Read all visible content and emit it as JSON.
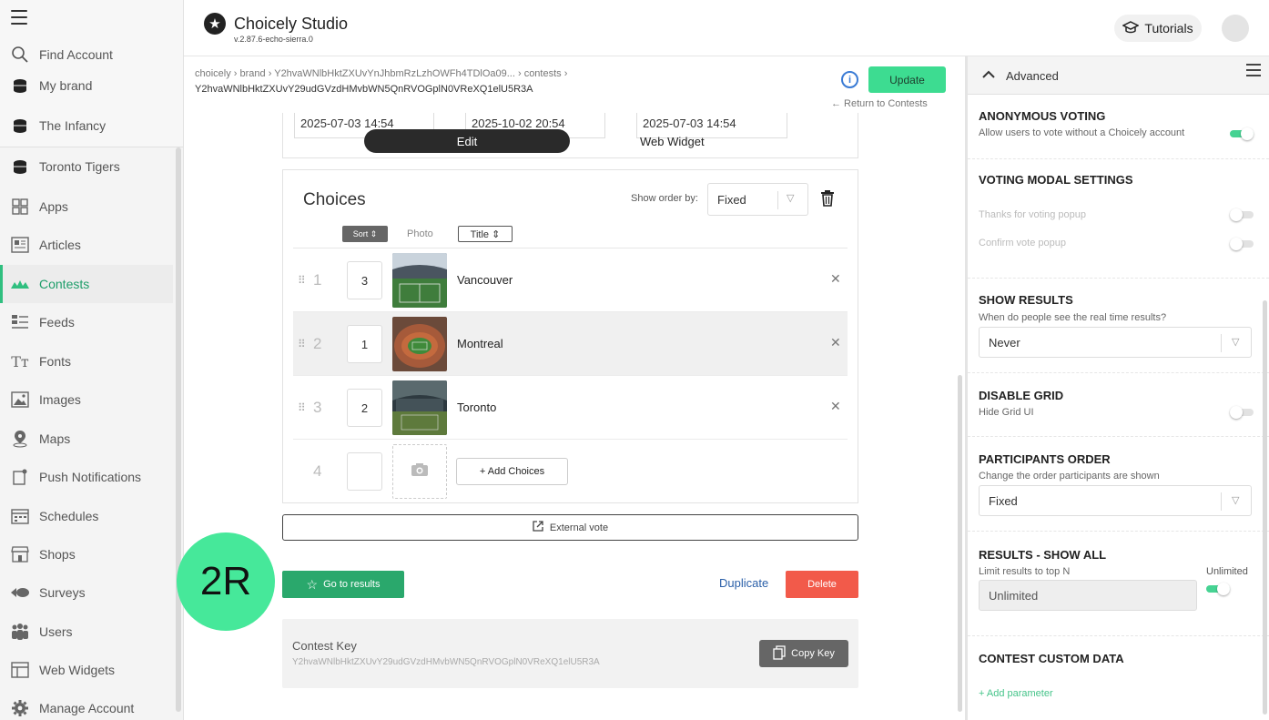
{
  "app": {
    "title": "Choicely Studio",
    "version": "v.2.87.6-echo-sierra.0",
    "tutorials_label": "Tutorials",
    "update_label": "Update",
    "return_label": "← Return to Contests"
  },
  "sidebar": {
    "items": [
      {
        "label": "Find Account",
        "icon": "search-icon"
      },
      {
        "label": "My brand",
        "icon": "brand-icon"
      },
      {
        "label": "The Infancy",
        "icon": "brand-icon"
      },
      {
        "label": "Toronto Tigers",
        "icon": "brand-icon"
      },
      {
        "label": "Apps",
        "icon": "apps-icon"
      },
      {
        "label": "Articles",
        "icon": "articles-icon"
      },
      {
        "label": "Contests",
        "icon": "contests-icon"
      },
      {
        "label": "Feeds",
        "icon": "feeds-icon"
      },
      {
        "label": "Fonts",
        "icon": "fonts-icon"
      },
      {
        "label": "Images",
        "icon": "images-icon"
      },
      {
        "label": "Maps",
        "icon": "maps-icon"
      },
      {
        "label": "Push Notifications",
        "icon": "push-icon"
      },
      {
        "label": "Schedules",
        "icon": "schedules-icon"
      },
      {
        "label": "Shops",
        "icon": "shops-icon"
      },
      {
        "label": "Surveys",
        "icon": "surveys-icon"
      },
      {
        "label": "Users",
        "icon": "users-icon"
      },
      {
        "label": "Web Widgets",
        "icon": "widgets-icon"
      },
      {
        "label": "Manage Account",
        "icon": "gear-icon"
      }
    ],
    "active": "Contests"
  },
  "breadcrumb": {
    "path": "choicely › brand › Y2hvaWNlbHktZXUvYnJhbmRzLzhOWFh4TDlOa09... › contests ›",
    "contest_id": "Y2hvaWNlbHktZXUvY29udGVzdHMvbWN5QnRVOGplN0VReXQ1elU5R3A"
  },
  "dates": [
    "2025-07-03 14:54",
    "2025-10-02 20:54",
    "2025-07-03 14:54"
  ],
  "tabs": {
    "edit": "Edit",
    "web_widget": "Web Widget"
  },
  "choices": {
    "title": "Choices",
    "show_order_label": "Show order by:",
    "show_order_value": "Fixed",
    "head_sort": "Sort ⇕",
    "head_photo": "Photo",
    "head_title": "Title ⇕",
    "rows": [
      {
        "num": "1",
        "order": "3",
        "name": "Vancouver"
      },
      {
        "num": "2",
        "order": "1",
        "name": "Montreal"
      },
      {
        "num": "3",
        "order": "2",
        "name": "Toronto"
      }
    ],
    "new_row_num": "4",
    "add_label": "+ Add Choices",
    "external_vote_label": "External vote"
  },
  "actions": {
    "results_label": "Go to results",
    "duplicate_label": "Duplicate",
    "delete_label": "Delete"
  },
  "contest_key": {
    "label": "Contest Key",
    "value": "Y2hvaWNlbHktZXUvY29udGVzdHMvbWN5QnRVOGplN0VReXQ1elU5R3A",
    "copy_label": "Copy Key"
  },
  "badge": "2R",
  "panel": {
    "header": "Advanced",
    "anon_title": "ANONYMOUS VOTING",
    "anon_desc": "Allow users to vote without a Choicely account",
    "anon_on": true,
    "modal_title": "VOTING MODAL SETTINGS",
    "thanks_popup": "Thanks for voting popup",
    "confirm_popup": "Confirm vote popup",
    "show_results_title": "SHOW RESULTS",
    "show_results_desc": "When do people see the real time results?",
    "show_results_value": "Never",
    "disable_grid_title": "DISABLE GRID",
    "disable_grid_desc": "Hide Grid UI",
    "order_title": "PARTICIPANTS ORDER",
    "order_desc": "Change the order participants are shown",
    "order_value": "Fixed",
    "results_all_title": "RESULTS - SHOW ALL",
    "results_all_desc": "Limit results to top N",
    "results_all_unlimited_label": "Unlimited",
    "results_all_value": "Unlimited",
    "custom_data_title": "CONTEST CUSTOM DATA",
    "add_param": "+ Add parameter"
  },
  "colors": {
    "accent": "#2fbf7f",
    "update": "#3ddc91",
    "delete": "#f25a4a",
    "link": "#2a5fa8"
  }
}
